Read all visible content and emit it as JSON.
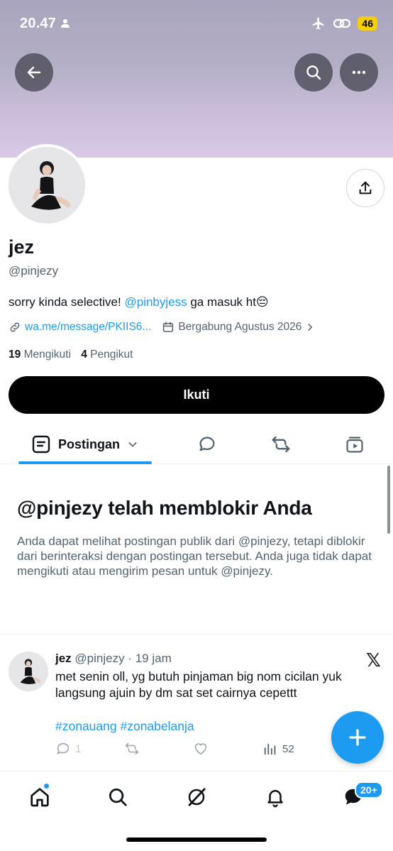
{
  "status_bar": {
    "time": "20.47",
    "battery": "46"
  },
  "profile": {
    "name": "jez",
    "handle": "@pinjezy",
    "bio_prefix": "sorry kinda selective! ",
    "bio_mention": "@pinbyjess",
    "bio_suffix": " ga masuk ht😔",
    "website": "wa.me/message/PKIIS6...",
    "joined": "Bergabung Agustus 2026",
    "following_count": "19",
    "following_label": "Mengikuti",
    "followers_count": "4",
    "followers_label": "Pengikut",
    "follow_button": "Ikuti"
  },
  "tabs": {
    "active_label": "Postingan"
  },
  "blocked": {
    "title": "@pinjezy telah memblokir Anda",
    "description": "Anda dapat melihat postingan publik dari @pinjezy, tetapi diblokir dari berinteraksi dengan postingan tersebut. Anda juga tidak dapat mengikuti atau mengirim pesan untuk @pinjezy."
  },
  "post": {
    "author_name": "jez",
    "author_handle": "@pinjezy",
    "time": "· 19 jam",
    "text": "met senin oll, yg butuh pinjaman big nom cicilan yuk langsung ajuin by dm sat set cairnya cepettt",
    "hashtags": "#zonauang #zonabelanja",
    "replies": "1",
    "views": "52"
  },
  "nav": {
    "messages_badge": "20+"
  },
  "colors": {
    "accent": "#1d9bf0",
    "text": "#0f1419",
    "muted": "#536471"
  }
}
